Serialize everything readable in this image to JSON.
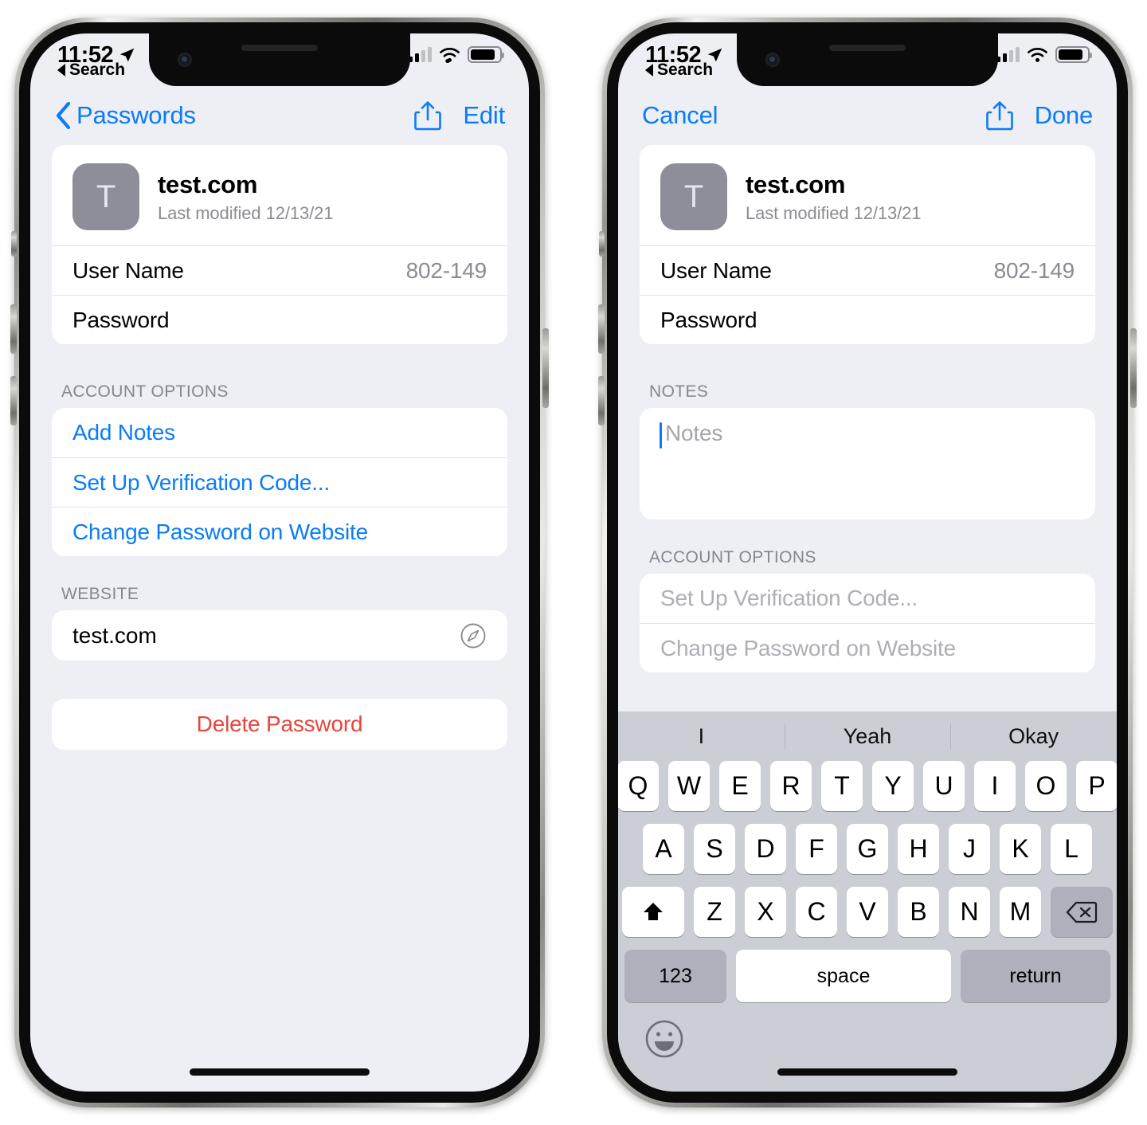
{
  "status_bar": {
    "time": "11:52",
    "location_icon": "location-arrow-icon",
    "back_to_app": "Search",
    "signal_icon": "cellular-signal-icon",
    "wifi_icon": "wifi-icon",
    "battery_icon": "battery-icon"
  },
  "colors": {
    "accent_blue": "#0a7cf7",
    "destructive_red": "#e8453c",
    "page_background": "#eeeef5",
    "card_background": "#ffffff",
    "secondary_text": "#8b8b93",
    "disabled_text": "#aeaeb6",
    "keyboard_background": "#ccced6",
    "icon_tile": "#8e8e9a"
  },
  "phone_left": {
    "nav": {
      "back_label": "Passwords",
      "back_icon": "chevron-left-icon",
      "share_icon": "share-icon",
      "edit_label": "Edit"
    },
    "account": {
      "icon_letter": "T",
      "name": "test.com",
      "last_modified": "Last modified 12/13/21",
      "rows": [
        {
          "label": "User Name",
          "value": "802-149"
        },
        {
          "label": "Password",
          "value": ""
        }
      ]
    },
    "account_options": {
      "header": "ACCOUNT OPTIONS",
      "items": [
        {
          "label": "Add Notes"
        },
        {
          "label": "Set Up Verification Code..."
        },
        {
          "label": "Change Password on Website"
        }
      ]
    },
    "website": {
      "header": "WEBSITE",
      "value": "test.com",
      "open_icon": "safari-compass-icon"
    },
    "delete_label": "Delete Password"
  },
  "phone_right": {
    "nav": {
      "cancel_label": "Cancel",
      "share_icon": "share-icon",
      "done_label": "Done"
    },
    "account": {
      "icon_letter": "T",
      "name": "test.com",
      "last_modified": "Last modified 12/13/21",
      "rows": [
        {
          "label": "User Name",
          "value": "802-149"
        },
        {
          "label": "Password",
          "value": ""
        }
      ]
    },
    "notes": {
      "header": "NOTES",
      "placeholder": "Notes",
      "value": ""
    },
    "account_options": {
      "header": "ACCOUNT OPTIONS",
      "items": [
        {
          "label": "Set Up Verification Code..."
        },
        {
          "label": "Change Password on Website"
        }
      ]
    },
    "keyboard": {
      "predictions": [
        "I",
        "Yeah",
        "Okay"
      ],
      "row1": [
        "Q",
        "W",
        "E",
        "R",
        "T",
        "Y",
        "U",
        "I",
        "O",
        "P"
      ],
      "row2": [
        "A",
        "S",
        "D",
        "F",
        "G",
        "H",
        "J",
        "K",
        "L"
      ],
      "row3": [
        "Z",
        "X",
        "C",
        "V",
        "B",
        "N",
        "M"
      ],
      "shift_icon": "shift-arrow-icon",
      "backspace_icon": "backspace-icon",
      "numbers_label": "123",
      "space_label": "space",
      "return_label": "return",
      "emoji_icon": "emoji-smiley-icon"
    }
  }
}
